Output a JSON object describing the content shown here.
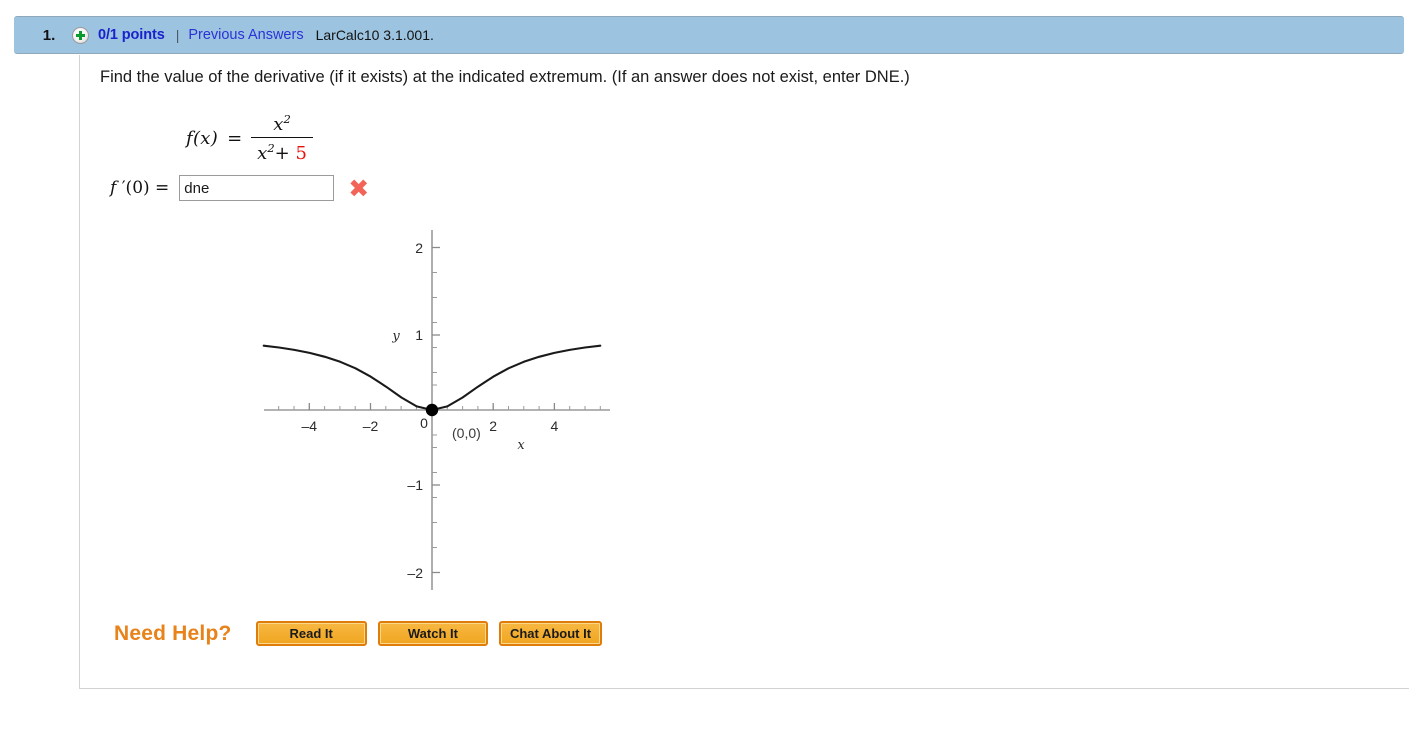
{
  "header": {
    "question_number": "1.",
    "plus_icon": "plus-circle-icon",
    "points": "0/1 points",
    "separator": "|",
    "previous_answers_label": "Previous Answers",
    "reference_code": "LarCalc10 3.1.001.",
    "bar_color": "#9cc3e0",
    "points_color": "#1a22cc",
    "link_color": "#2a33d8"
  },
  "question": {
    "prompt": "Find the value of the derivative (if it exists) at the indicated extremum. (If an answer does not exist, enter DNE.)",
    "formula": {
      "lhs": "f(x)",
      "equals": "=",
      "numerator_base": "x",
      "numerator_exponent": "2",
      "denominator_base": "x",
      "denominator_exponent": "2",
      "denominator_plus": "+",
      "denominator_constant": "5",
      "constant_color": "#e8120b"
    },
    "answer": {
      "label_f": "f",
      "label_rest": " ′(0)  =",
      "value": "dne",
      "placeholder": "",
      "status_icon": "x-mark-incorrect",
      "status_icon_glyph": "✖",
      "status_color": "#f26358"
    }
  },
  "chart_data": {
    "type": "line",
    "title": "",
    "xlabel": "x",
    "ylabel": "y",
    "xlim": [
      -5.6,
      5.6
    ],
    "ylim": [
      -2.0,
      2.0
    ],
    "xticks": [
      -4,
      -2,
      0,
      2,
      4
    ],
    "xtick_labels": [
      "–4",
      "–2",
      "0",
      "2",
      "4"
    ],
    "yticks": [
      2,
      1,
      0,
      -1,
      -2
    ],
    "ytick_labels": [
      "2",
      "1",
      "0",
      "–1",
      "–2"
    ],
    "minor_tick_step": 0.5,
    "grid": false,
    "legend": false,
    "series": [
      {
        "name": "f(x) = x^2/(x^2+5)",
        "x": [
          -5.5,
          -5.0,
          -4.5,
          -4.0,
          -3.5,
          -3.0,
          -2.5,
          -2.0,
          -1.5,
          -1.0,
          -0.5,
          0.0,
          0.5,
          1.0,
          1.5,
          2.0,
          2.5,
          3.0,
          3.5,
          4.0,
          4.5,
          5.0,
          5.5
        ],
        "y": [
          0.858,
          0.833,
          0.802,
          0.762,
          0.709,
          0.643,
          0.556,
          0.444,
          0.31,
          0.167,
          0.048,
          0.0,
          0.048,
          0.167,
          0.31,
          0.444,
          0.556,
          0.643,
          0.709,
          0.762,
          0.802,
          0.833,
          0.858
        ],
        "color": "#1a1a1a"
      }
    ],
    "annotations": [
      {
        "type": "point",
        "label": "(0,0)",
        "x": 0,
        "y": 0,
        "marker": "filled-circle",
        "color": "#000000"
      }
    ]
  },
  "help": {
    "title": "Need Help?",
    "title_color": "#e8821a",
    "buttons": [
      {
        "label": "Read It"
      },
      {
        "label": "Watch It"
      },
      {
        "label": "Chat About It"
      }
    ]
  }
}
